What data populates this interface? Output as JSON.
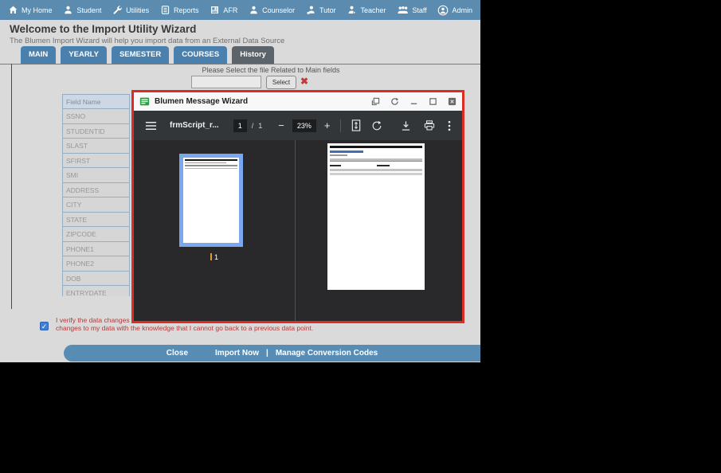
{
  "nav": {
    "items": [
      {
        "label": "My Home"
      },
      {
        "label": "Student"
      },
      {
        "label": "Utilities"
      },
      {
        "label": "Reports"
      },
      {
        "label": "AFR"
      },
      {
        "label": "Counselor"
      },
      {
        "label": "Tutor"
      },
      {
        "label": "Teacher"
      },
      {
        "label": "Staff"
      },
      {
        "label": "Admin"
      }
    ]
  },
  "header": {
    "title": "Welcome to the Import Utility Wizard",
    "subtitle": "The Blumen Import Wizard will help you import data from an External Data Source"
  },
  "tabs": {
    "items": [
      {
        "label": "MAIN"
      },
      {
        "label": "YEARLY"
      },
      {
        "label": "SEMESTER"
      },
      {
        "label": "COURSES"
      },
      {
        "label": "History"
      }
    ]
  },
  "file_select": {
    "prompt": "Please Select the file Related to Main fields",
    "input_value": "",
    "select_label": "Select",
    "clear_glyph": "✖"
  },
  "field_table": {
    "header": "Field Name",
    "rows": [
      "SSNO",
      "STUDENTID",
      "SLAST",
      "SFIRST",
      "SMI",
      "ADDRESS",
      "CITY",
      "STATE",
      "ZIPCODE",
      "PHONE1",
      "PHONE2",
      "DOB",
      "ENTRYDATE"
    ]
  },
  "modal": {
    "title": "Blumen Message Wizard",
    "pdf_toolbar": {
      "filename": "frmScript_r...",
      "page": "1",
      "page_separator": "/",
      "page_count": "1",
      "zoom_out": "−",
      "zoom_level": "23%",
      "zoom_in": "+"
    },
    "thumbnail": {
      "page_label": "1"
    }
  },
  "verify": {
    "checkmark": "✓",
    "line1": "I verify the data changes to",
    "line2": "changes to my data with the knowledge that I cannot go back to a previous data point."
  },
  "footer": {
    "close_label": "Close",
    "import_label": "Import Now",
    "separator": "|",
    "manage_label": "Manage Conversion Codes"
  },
  "colors": {
    "nav_blue": "#5b8cb0",
    "tab_blue": "#4a80ad",
    "active_tab_gray": "#5c646b",
    "modal_border_red": "#dd2c23",
    "pdf_toolbar_dark": "#323639",
    "viewer_dark": "#29292c",
    "thumb_highlight_blue": "#7aa8ee",
    "warning_red": "#b43a3a",
    "footer_blue": "#578cb4"
  }
}
